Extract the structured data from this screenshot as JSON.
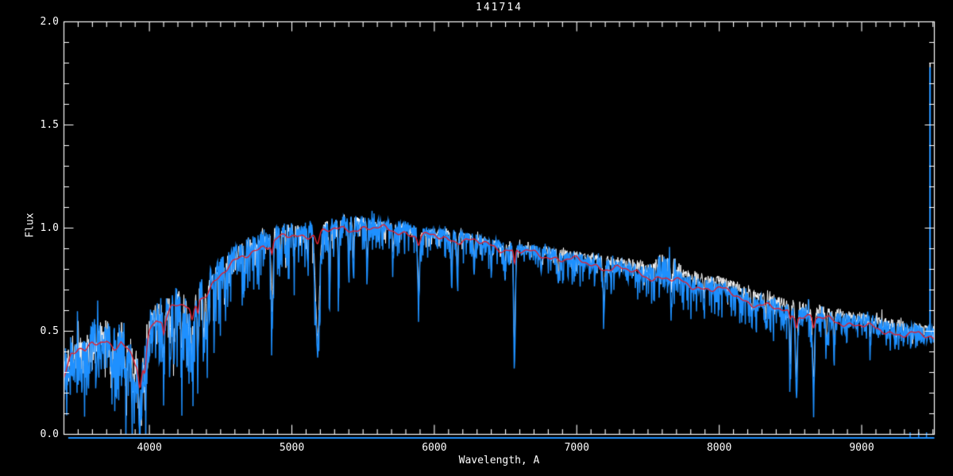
{
  "title": "141714",
  "axes": {
    "xlabel": "Wavelength, A",
    "ylabel": "Flux",
    "xticks": [
      {
        "label": "4000",
        "wavelength": 4000
      },
      {
        "label": "5000",
        "wavelength": 5000
      },
      {
        "label": "6000",
        "wavelength": 6000
      },
      {
        "label": "7000",
        "wavelength": 7000
      },
      {
        "label": "8000",
        "wavelength": 8000
      },
      {
        "label": "9000",
        "wavelength": 9000
      }
    ],
    "yticks": [
      {
        "label": "2.0",
        "flux": 2.0
      },
      {
        "label": "1.5",
        "flux": 1.5
      },
      {
        "label": "1.0",
        "flux": 1.0
      },
      {
        "label": "0.5",
        "flux": 0.5
      },
      {
        "label": "0.0",
        "flux": 0.0
      }
    ],
    "x_minor_step": 100,
    "y_minor_step": 0.1
  },
  "colors": {
    "background": "#000000",
    "frame": "#ffffff",
    "observed_blue": "#1e90ff",
    "observed_white": "#ffffff",
    "model_red": "#e02030"
  },
  "chart_data": {
    "type": "line",
    "title": "141714",
    "xlabel": "Wavelength, A",
    "ylabel": "Flux",
    "xlim": [
      3400,
      9510
    ],
    "ylim": [
      0.0,
      2.0
    ],
    "grid": false,
    "legend": "none",
    "series": [
      {
        "name": "observed-spectrum-blue",
        "color": "#1e90ff",
        "style": "noisy-line",
        "continuum": [
          [
            3400,
            0.33
          ],
          [
            3450,
            0.41
          ],
          [
            3500,
            0.43
          ],
          [
            3550,
            0.41
          ],
          [
            3600,
            0.46
          ],
          [
            3650,
            0.47
          ],
          [
            3700,
            0.48
          ],
          [
            3750,
            0.44
          ],
          [
            3800,
            0.47
          ],
          [
            3850,
            0.42
          ],
          [
            3900,
            0.34
          ],
          [
            3950,
            0.33
          ],
          [
            4000,
            0.53
          ],
          [
            4050,
            0.6
          ],
          [
            4100,
            0.58
          ],
          [
            4150,
            0.64
          ],
          [
            4200,
            0.65
          ],
          [
            4250,
            0.65
          ],
          [
            4300,
            0.62
          ],
          [
            4350,
            0.69
          ],
          [
            4400,
            0.72
          ],
          [
            4450,
            0.77
          ],
          [
            4500,
            0.8
          ],
          [
            4550,
            0.83
          ],
          [
            4600,
            0.86
          ],
          [
            4650,
            0.89
          ],
          [
            4700,
            0.91
          ],
          [
            4750,
            0.93
          ],
          [
            4800,
            0.95
          ],
          [
            4850,
            0.94
          ],
          [
            4900,
            0.97
          ],
          [
            4950,
            0.99
          ],
          [
            5000,
            0.99
          ],
          [
            5100,
            1.0
          ],
          [
            5200,
            1.0
          ],
          [
            5300,
            1.02
          ],
          [
            5400,
            1.03
          ],
          [
            5500,
            1.03
          ],
          [
            5600,
            1.02
          ],
          [
            5700,
            1.01
          ],
          [
            5800,
            1.0
          ],
          [
            5900,
            0.98
          ],
          [
            6000,
            0.98
          ],
          [
            6100,
            0.97
          ],
          [
            6200,
            0.96
          ],
          [
            6300,
            0.95
          ],
          [
            6400,
            0.93
          ],
          [
            6500,
            0.91
          ],
          [
            6600,
            0.9
          ],
          [
            6700,
            0.89
          ],
          [
            6800,
            0.88
          ],
          [
            6900,
            0.86
          ],
          [
            7000,
            0.85
          ],
          [
            7100,
            0.84
          ],
          [
            7200,
            0.82
          ],
          [
            7300,
            0.81
          ],
          [
            7400,
            0.8
          ],
          [
            7500,
            0.78
          ],
          [
            7600,
            0.77
          ],
          [
            7700,
            0.76
          ],
          [
            7800,
            0.74
          ],
          [
            7900,
            0.72
          ],
          [
            8000,
            0.71
          ],
          [
            8100,
            0.69
          ],
          [
            8200,
            0.655
          ],
          [
            8300,
            0.635
          ],
          [
            8400,
            0.62
          ],
          [
            8500,
            0.6
          ],
          [
            8600,
            0.585
          ],
          [
            8700,
            0.57
          ],
          [
            8800,
            0.56
          ],
          [
            8900,
            0.55
          ],
          [
            9000,
            0.54
          ],
          [
            9100,
            0.52
          ],
          [
            9200,
            0.51
          ],
          [
            9300,
            0.5
          ],
          [
            9400,
            0.49
          ],
          [
            9510,
            0.49
          ]
        ],
        "noise_amplitude": [
          [
            3400,
            0.09
          ],
          [
            3700,
            0.1
          ],
          [
            3900,
            0.11
          ],
          [
            4000,
            0.08
          ],
          [
            4200,
            0.07
          ],
          [
            4400,
            0.06
          ],
          [
            4600,
            0.05
          ],
          [
            4800,
            0.045
          ],
          [
            5000,
            0.04
          ],
          [
            5400,
            0.03
          ],
          [
            5800,
            0.025
          ],
          [
            6200,
            0.025
          ],
          [
            6600,
            0.025
          ],
          [
            7000,
            0.03
          ],
          [
            7400,
            0.03
          ],
          [
            7600,
            0.045
          ],
          [
            7700,
            0.035
          ],
          [
            8000,
            0.03
          ],
          [
            8400,
            0.03
          ],
          [
            8800,
            0.035
          ],
          [
            9200,
            0.04
          ],
          [
            9510,
            0.045
          ]
        ],
        "spike_prob_depth": [
          [
            3400,
            0.5,
            0.22
          ],
          [
            4000,
            0.45,
            0.3
          ],
          [
            4600,
            0.35,
            0.28
          ],
          [
            5000,
            0.3,
            0.22
          ],
          [
            5600,
            0.28,
            0.15
          ],
          [
            6300,
            0.25,
            0.12
          ],
          [
            7000,
            0.28,
            0.13
          ],
          [
            7600,
            0.3,
            0.15
          ],
          [
            8300,
            0.3,
            0.16
          ],
          [
            9000,
            0.22,
            0.09
          ],
          [
            9510,
            0.22,
            0.08
          ]
        ],
        "absorption_lines": [
          [
            3735,
            0.22,
            6
          ],
          [
            3770,
            0.15,
            5
          ],
          [
            3835,
            0.2,
            6
          ],
          [
            3890,
            0.16,
            5
          ],
          [
            3933,
            0.22,
            10
          ],
          [
            3968,
            0.2,
            7
          ],
          [
            4101,
            0.24,
            6
          ],
          [
            4144,
            0.12,
            5
          ],
          [
            4172,
            0.26,
            5
          ],
          [
            4226,
            0.28,
            5
          ],
          [
            4271,
            0.18,
            5
          ],
          [
            4300,
            0.26,
            12
          ],
          [
            4340,
            0.28,
            5
          ],
          [
            4383,
            0.3,
            5
          ],
          [
            4405,
            0.26,
            5
          ],
          [
            4455,
            0.2,
            4
          ],
          [
            4531,
            0.16,
            4
          ],
          [
            4668,
            0.18,
            4
          ],
          [
            4861,
            0.45,
            6
          ],
          [
            4920,
            0.15,
            4
          ],
          [
            4957,
            0.12,
            4
          ],
          [
            5015,
            0.14,
            4
          ],
          [
            5110,
            0.15,
            4
          ],
          [
            5180,
            0.6,
            14
          ],
          [
            5265,
            0.4,
            4
          ],
          [
            5328,
            0.3,
            4
          ],
          [
            5400,
            0.25,
            4
          ],
          [
            5430,
            0.22,
            4
          ],
          [
            5530,
            0.2,
            4
          ],
          [
            5711,
            0.15,
            4
          ],
          [
            5890,
            0.33,
            7
          ],
          [
            6122,
            0.25,
            4
          ],
          [
            6162,
            0.24,
            4
          ],
          [
            6280,
            0.15,
            4
          ],
          [
            6400,
            0.16,
            4
          ],
          [
            6495,
            0.14,
            4
          ],
          [
            6563,
            0.55,
            6
          ],
          [
            6750,
            0.1,
            4
          ],
          [
            6870,
            0.12,
            5
          ],
          [
            7190,
            0.22,
            6
          ],
          [
            7665,
            0.1,
            5
          ],
          [
            7890,
            0.1,
            4
          ],
          [
            8230,
            0.12,
            5
          ],
          [
            8327,
            0.12,
            4
          ],
          [
            8498,
            0.3,
            5
          ],
          [
            8542,
            0.4,
            7
          ],
          [
            8662,
            0.38,
            7
          ],
          [
            8750,
            0.16,
            4
          ],
          [
            8806,
            0.14,
            4
          ],
          [
            9060,
            0.08,
            4
          ],
          [
            9240,
            0.08,
            4
          ]
        ],
        "emission_spike": {
          "wavelength": 9480,
          "flux_top": 1.78
        },
        "telluric_bump": {
          "from": 7570,
          "to": 7700
        }
      },
      {
        "name": "observed-spectrum-white",
        "color": "#ffffff",
        "style": "noisy-line",
        "offset_above_blue": [
          [
            3400,
            0.0
          ],
          [
            6600,
            0.0
          ],
          [
            6800,
            0.01
          ],
          [
            7000,
            0.02
          ],
          [
            7600,
            0.03
          ],
          [
            8000,
            0.035
          ],
          [
            8600,
            0.03
          ],
          [
            9000,
            0.025
          ],
          [
            9300,
            0.02
          ],
          [
            9510,
            0.015
          ]
        ],
        "emission_spike": {
          "wavelength": 9480,
          "flux_top": 1.8
        }
      },
      {
        "name": "model-spectrum-red",
        "color": "#e02030",
        "style": "smooth-line",
        "anchors": [
          [
            3400,
            0.28
          ],
          [
            3450,
            0.39
          ],
          [
            3500,
            0.41
          ],
          [
            3550,
            0.39
          ],
          [
            3600,
            0.44
          ],
          [
            3650,
            0.45
          ],
          [
            3700,
            0.46
          ],
          [
            3750,
            0.42
          ],
          [
            3800,
            0.45
          ],
          [
            3850,
            0.4
          ],
          [
            3900,
            0.33
          ],
          [
            3950,
            0.32
          ],
          [
            4000,
            0.5
          ],
          [
            4050,
            0.57
          ],
          [
            4100,
            0.55
          ],
          [
            4150,
            0.61
          ],
          [
            4200,
            0.62
          ],
          [
            4250,
            0.62
          ],
          [
            4300,
            0.59
          ],
          [
            4350,
            0.66
          ],
          [
            4400,
            0.69
          ],
          [
            4450,
            0.74
          ],
          [
            4500,
            0.77
          ],
          [
            4550,
            0.8
          ],
          [
            4600,
            0.83
          ],
          [
            4650,
            0.86
          ],
          [
            4700,
            0.88
          ],
          [
            4750,
            0.9
          ],
          [
            4800,
            0.92
          ],
          [
            4850,
            0.91
          ],
          [
            4900,
            0.94
          ],
          [
            4950,
            0.96
          ],
          [
            5000,
            0.96
          ],
          [
            5100,
            0.97
          ],
          [
            5200,
            0.975
          ],
          [
            5300,
            0.99
          ],
          [
            5400,
            1.0
          ],
          [
            5500,
            1.0
          ],
          [
            5600,
            0.995
          ],
          [
            5700,
            0.99
          ],
          [
            5800,
            0.98
          ],
          [
            5900,
            0.955
          ],
          [
            6000,
            0.96
          ],
          [
            6100,
            0.95
          ],
          [
            6200,
            0.94
          ],
          [
            6300,
            0.93
          ],
          [
            6400,
            0.915
          ],
          [
            6500,
            0.9
          ],
          [
            6600,
            0.885
          ],
          [
            6700,
            0.875
          ],
          [
            6800,
            0.865
          ],
          [
            6900,
            0.85
          ],
          [
            7000,
            0.84
          ],
          [
            7100,
            0.825
          ],
          [
            7200,
            0.81
          ],
          [
            7300,
            0.8
          ],
          [
            7400,
            0.785
          ],
          [
            7500,
            0.77
          ],
          [
            7600,
            0.755
          ],
          [
            7700,
            0.74
          ],
          [
            7800,
            0.725
          ],
          [
            7900,
            0.71
          ],
          [
            8000,
            0.7
          ],
          [
            8100,
            0.68
          ],
          [
            8200,
            0.645
          ],
          [
            8300,
            0.625
          ],
          [
            8400,
            0.605
          ],
          [
            8500,
            0.59
          ],
          [
            8600,
            0.575
          ],
          [
            8700,
            0.56
          ],
          [
            8800,
            0.55
          ],
          [
            8900,
            0.54
          ],
          [
            9000,
            0.53
          ],
          [
            9100,
            0.505
          ],
          [
            9200,
            0.495
          ],
          [
            9300,
            0.49
          ],
          [
            9400,
            0.48
          ],
          [
            9510,
            0.46
          ]
        ],
        "line_dips": [
          [
            3933,
            0.1,
            10
          ],
          [
            3968,
            0.08,
            8
          ],
          [
            4101,
            0.05,
            6
          ],
          [
            4300,
            0.05,
            10
          ],
          [
            4340,
            0.05,
            6
          ],
          [
            4861,
            0.05,
            6
          ],
          [
            5180,
            0.05,
            12
          ],
          [
            5890,
            0.035,
            8
          ],
          [
            6563,
            0.07,
            6
          ],
          [
            8498,
            0.03,
            6
          ],
          [
            8542,
            0.05,
            7
          ],
          [
            8662,
            0.05,
            7
          ]
        ]
      }
    ],
    "error_spectrum": {
      "color": "#1e90ff",
      "approx_flux": -0.02,
      "from_wavelength": 3430,
      "to_wavelength": 9510,
      "end_blips_wavelengths": [
        9340,
        9400,
        9455
      ]
    }
  }
}
